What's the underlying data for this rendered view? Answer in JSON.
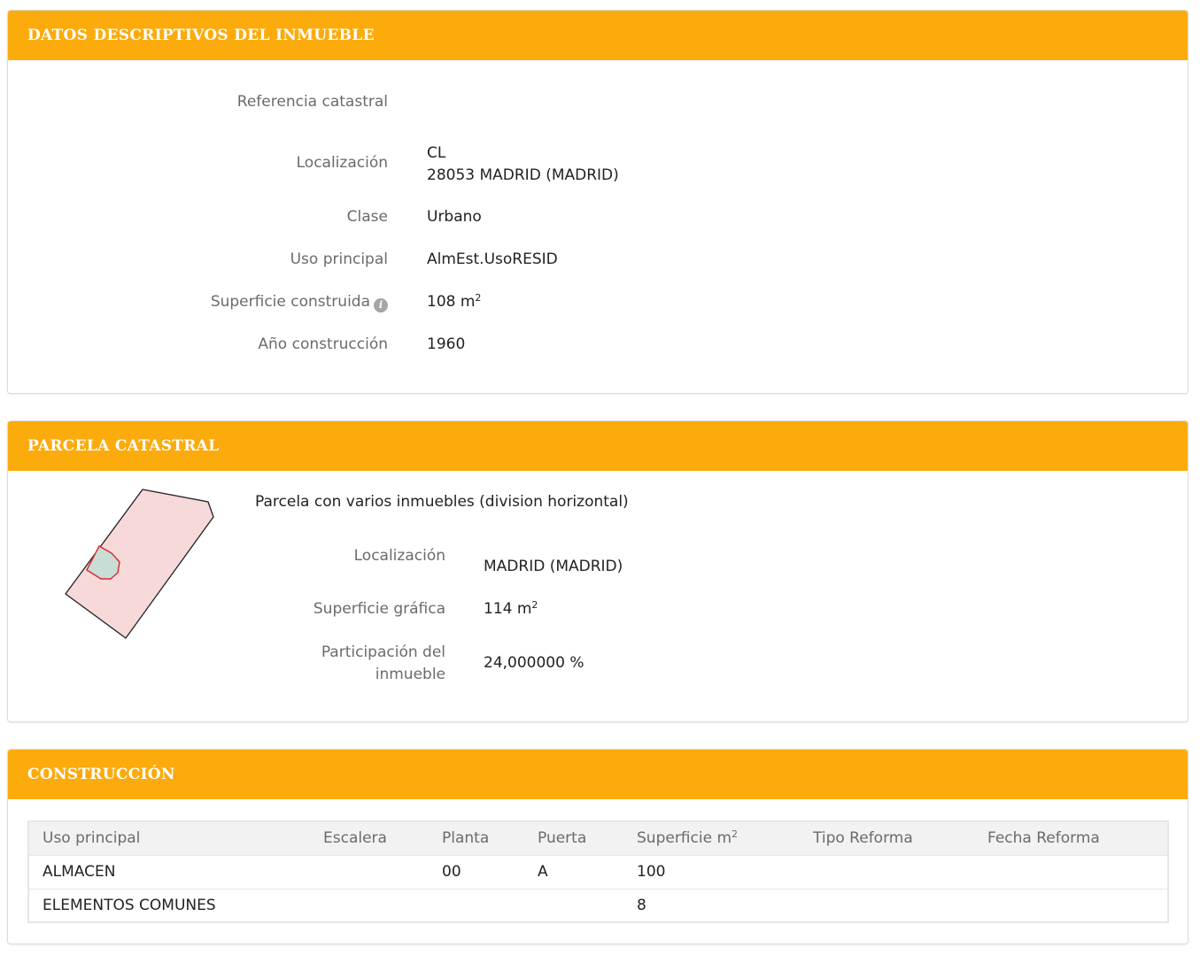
{
  "datos": {
    "title": "DATOS DESCRIPTIVOS DEL INMUEBLE",
    "referencia_label": "Referencia catastral",
    "localizacion_label": "Localización",
    "localizacion_line1": "CL",
    "localizacion_line2": "28053 MADRID (MADRID)",
    "clase_label": "Clase",
    "clase_value": "Urbano",
    "uso_label": "Uso principal",
    "uso_value": "AlmEst.UsoRESID",
    "superficie_label": "Superficie construida",
    "superficie_value": "108 m",
    "superficie_sup": "2",
    "info_icon": "i",
    "anio_label": "Año construcción",
    "anio_value": "1960"
  },
  "parcela": {
    "title": "PARCELA CATASTRAL",
    "description": "Parcela con varios inmuebles (division horizontal)",
    "localizacion_label": "Localización",
    "localizacion_value": "MADRID (MADRID)",
    "superficie_label": "Superficie gráfica",
    "superficie_value": "114 m",
    "superficie_sup": "2",
    "participacion_label_1": "Participación del",
    "participacion_label_2": "inmueble",
    "participacion_value": "24,000000 %",
    "map_colors": {
      "parcel_fill": "#f7d9d9",
      "parcel_stroke": "#222222",
      "unit_fill": "#c8ddd6",
      "unit_stroke": "#d9262b"
    }
  },
  "construccion": {
    "title": "CONSTRUCCIÓN",
    "columns": [
      "Uso principal",
      "Escalera",
      "Planta",
      "Puerta",
      "Superficie m",
      "Tipo Reforma",
      "Fecha Reforma"
    ],
    "superficie_sup": "2",
    "rows": [
      [
        "ALMACEN",
        "",
        "00",
        "A",
        "100",
        "",
        ""
      ],
      [
        "ELEMENTOS COMUNES",
        "",
        "",
        "",
        "8",
        "",
        ""
      ]
    ]
  },
  "colors": {
    "header": "#fcab0c",
    "label": "#6b6b6b"
  }
}
